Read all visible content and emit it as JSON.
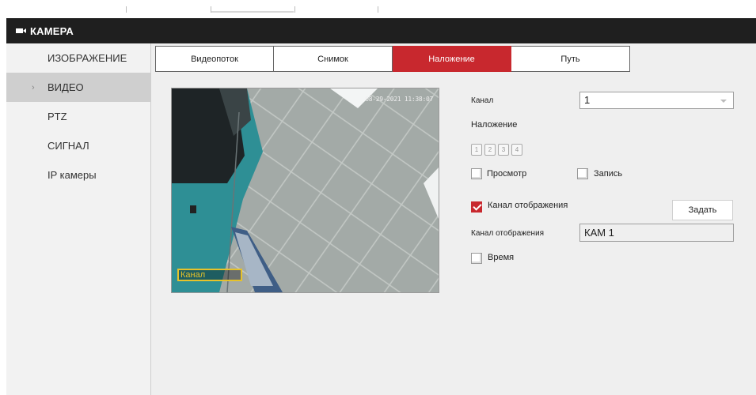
{
  "window": {
    "title": "КАМЕРА",
    "icon": "camera-icon"
  },
  "sidebar": {
    "items": [
      {
        "label": "ИЗОБРАЖЕНИЕ",
        "active": false
      },
      {
        "label": "ВИДЕО",
        "active": true
      },
      {
        "label": "PTZ",
        "active": false
      },
      {
        "label": "СИГНАЛ",
        "active": false
      },
      {
        "label": "IP камеры",
        "active": false
      }
    ]
  },
  "tabs": [
    {
      "label": "Видеопоток",
      "active": false
    },
    {
      "label": "Снимок",
      "active": false
    },
    {
      "label": "Наложение",
      "active": true
    },
    {
      "label": "Путь",
      "active": false
    }
  ],
  "preview": {
    "timestamp": "08-29-2021 11:38:07",
    "channel_overlay_text": "Канал"
  },
  "form": {
    "channel_label": "Канал",
    "channel_value": "1",
    "overlay_label": "Наложение",
    "overlay_numbers": [
      "1",
      "2",
      "3",
      "4"
    ],
    "preview_label": "Просмотр",
    "preview_checked": false,
    "record_label": "Запись",
    "record_checked": false,
    "display_channel_label": "Канал отображения",
    "display_channel_checked": true,
    "set_button": "Задать",
    "display_channel_name_label": "Канал отображения",
    "display_channel_name_value": "КАМ 1",
    "time_label": "Время",
    "time_checked": false
  },
  "colors": {
    "accent": "#c8282e",
    "titlebar": "#1f1f1f",
    "overlay_box": "#e6c22a"
  }
}
